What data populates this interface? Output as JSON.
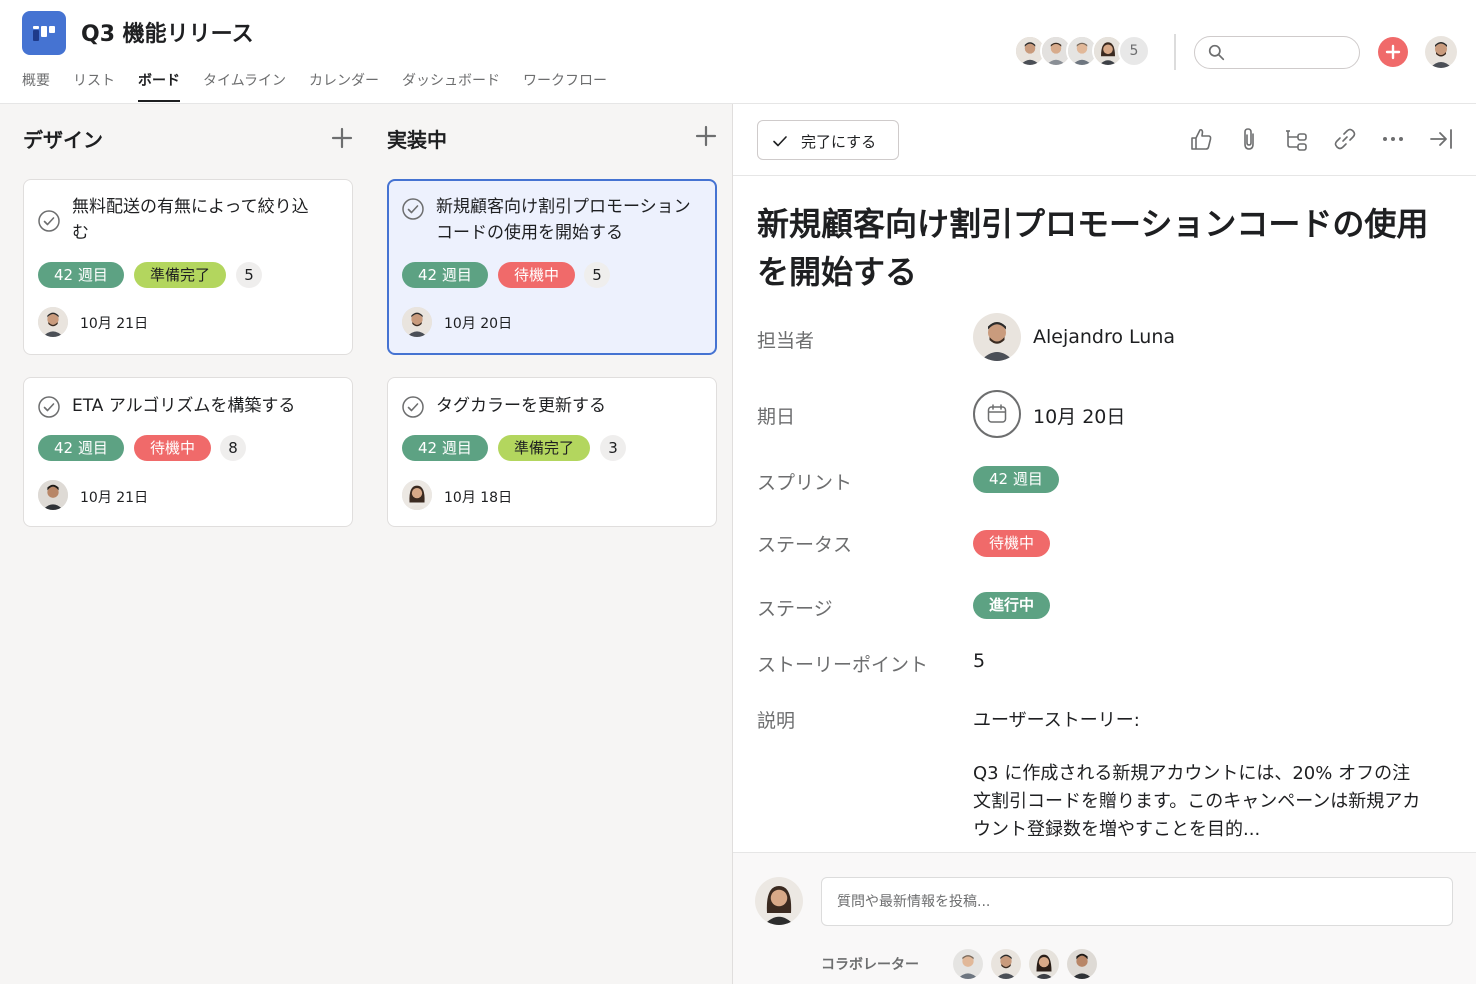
{
  "project": {
    "title": "Q3 機能リリース",
    "icon": "board-icon"
  },
  "tabs": [
    {
      "label": "概要"
    },
    {
      "label": "リスト"
    },
    {
      "label": "ボード",
      "active": true
    },
    {
      "label": "タイムライン"
    },
    {
      "label": "カレンダー"
    },
    {
      "label": "ダッシュボード"
    },
    {
      "label": "ワークフロー"
    }
  ],
  "header": {
    "member_count": "5",
    "search_placeholder": "",
    "icons": [
      "search-icon",
      "add-icon"
    ]
  },
  "columns": [
    {
      "title": "デザイン",
      "cards": [
        {
          "title": "無料配送の有無によって絞り込む",
          "sprint": "42 週目",
          "status": "準備完了",
          "points": "5",
          "date": "10月 21日"
        },
        {
          "title": "ETA アルゴリズムを構築する",
          "sprint": "42 週目",
          "status": "待機中",
          "points": "8",
          "date": "10月 21日"
        }
      ]
    },
    {
      "title": "実装中",
      "cards": [
        {
          "title": "新規顧客向け割引プロモーションコードの使用を開始する",
          "sprint": "42 週目",
          "status": "待機中",
          "points": "5",
          "date": "10月 20日",
          "selected": true
        },
        {
          "title": "タグカラーを更新する",
          "sprint": "42 週目",
          "status": "準備完了",
          "points": "3",
          "date": "10月 18日"
        }
      ]
    }
  ],
  "detail": {
    "complete_label": "完了にする",
    "title": "新規顧客向け割引プロモーションコードの使用を開始する",
    "fields": {
      "assignee": {
        "label": "担当者",
        "value": "Alejandro Luna"
      },
      "due": {
        "label": "期日",
        "value": "10月 20日"
      },
      "sprint": {
        "label": "スプリント",
        "value": "42 週目"
      },
      "status": {
        "label": "ステータス",
        "value": "待機中"
      },
      "stage": {
        "label": "ステージ",
        "value": "進行中"
      },
      "points": {
        "label": "ストーリーポイント",
        "value": "5"
      },
      "description": {
        "label": "説明",
        "heading": "ユーザーストーリー:",
        "body": "Q3 に作成される新規アカウントには、20% オフの注文割引コードを贈ります。このキャンペーンは新規アカウント登録数を増やすことを目的..."
      }
    },
    "toolbar_icons": [
      "thumbs-up-icon",
      "attachment-icon",
      "subtask-icon",
      "link-icon",
      "more-icon",
      "close-panel-icon"
    ],
    "comment_placeholder": "質問や最新情報を投稿...",
    "collaborators_label": "コラボレーター"
  },
  "colors": {
    "accent": "#4573d2",
    "green": "#5da283",
    "lime": "#b3d65e",
    "red": "#f06a6a",
    "board_bg": "#f6f5f4"
  }
}
